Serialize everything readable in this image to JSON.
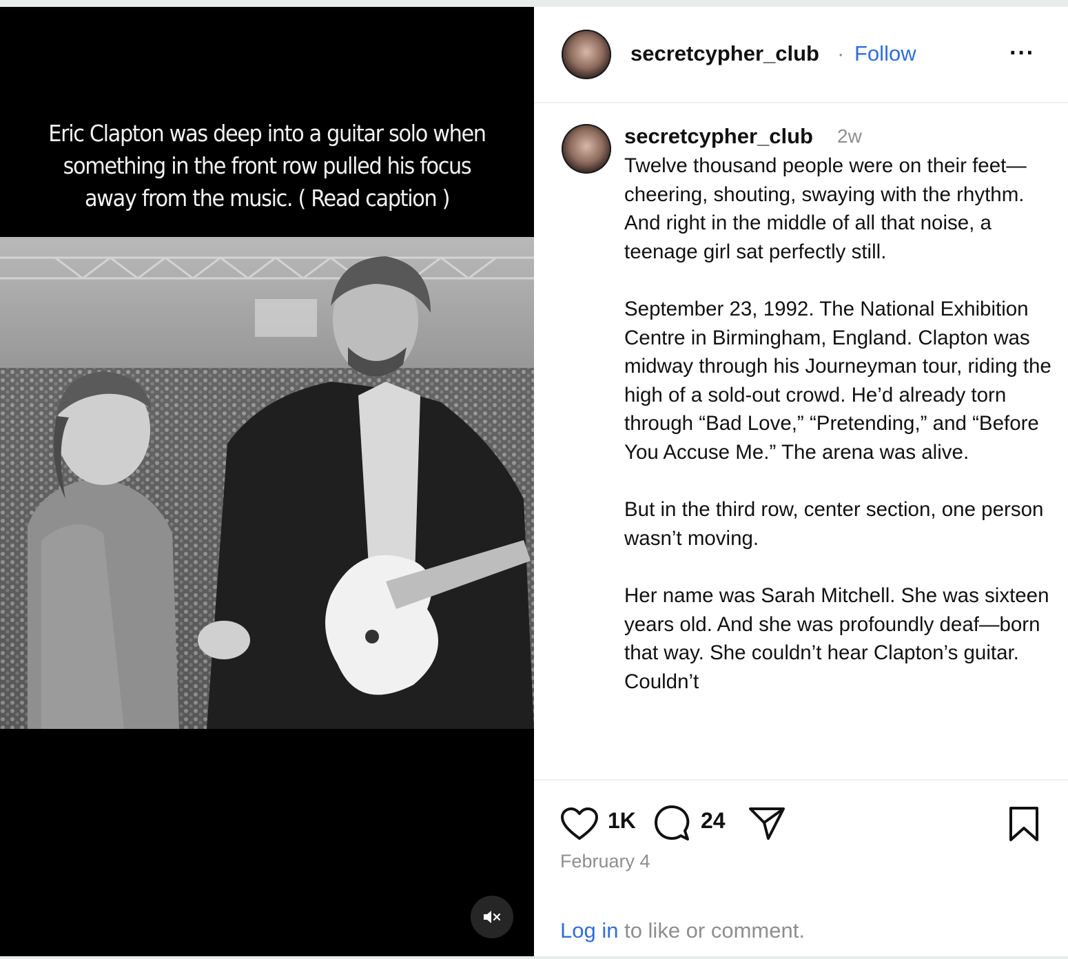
{
  "media": {
    "overlay_lines": [
      "Eric Clapton was deep into a guitar solo when",
      "something in the front row pulled his focus",
      "away from the music. ( Read caption )"
    ],
    "mute_icon": "speaker-muted-icon"
  },
  "header": {
    "username": "secretcypher_club",
    "separator": "·",
    "follow_label": "Follow",
    "more_label": "···"
  },
  "caption": {
    "username": "secretcypher_club",
    "time_ago": "2w",
    "text": "Twelve thousand people were on their feet—cheering, shouting, swaying with the rhythm. And right in the middle of all that noise, a teenage girl sat perfectly still.\n\nSeptember 23, 1992. The National Exhibition Centre in Birmingham, England. Clapton was midway through his Journeyman tour, riding the high of a sold-out crowd. He’d already torn through “Bad Love,” “Pretending,” and “Before You Accuse Me.” The arena was alive.\n\nBut in the third row, center section, one person wasn’t moving.\n\nHer name was Sarah Mitchell. She was sixteen years old. And she was profoundly deaf—born that way. She couldn’t hear Clapton’s guitar. Couldn’t"
  },
  "actions": {
    "likes": "1K",
    "comments": "24",
    "date": "February 4",
    "login_link": "Log in",
    "login_rest": " to like or comment."
  },
  "colors": {
    "link_blue": "#2f6de0",
    "muted_gray": "#8e8e8e",
    "text": "#111111"
  }
}
